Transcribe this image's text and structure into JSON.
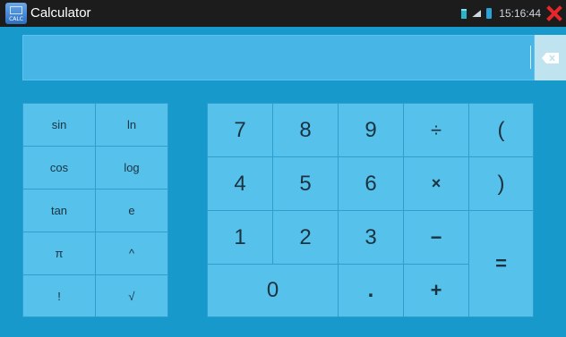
{
  "window": {
    "title": "Calculator",
    "app_icon_label": "CALC",
    "clock": "15:16:44"
  },
  "display": {
    "value": ""
  },
  "scientific": [
    {
      "label": "sin",
      "name": "sin-key"
    },
    {
      "label": "ln",
      "name": "ln-key"
    },
    {
      "label": "cos",
      "name": "cos-key"
    },
    {
      "label": "log",
      "name": "log-key"
    },
    {
      "label": "tan",
      "name": "tan-key"
    },
    {
      "label": "e",
      "name": "e-key"
    },
    {
      "label": "π",
      "name": "pi-key"
    },
    {
      "label": "^",
      "name": "power-key"
    },
    {
      "label": "!",
      "name": "factorial-key"
    },
    {
      "label": "√",
      "name": "sqrt-key"
    }
  ],
  "keypad": {
    "k7": "7",
    "k8": "8",
    "k9": "9",
    "div": "÷",
    "lparen": "(",
    "k4": "4",
    "k5": "5",
    "k6": "6",
    "mul": "×",
    "rparen": ")",
    "k1": "1",
    "k2": "2",
    "k3": "3",
    "sub": "−",
    "k0": "0",
    "dot": ".",
    "add": "+",
    "eq": "="
  },
  "colors": {
    "background": "#1799cc",
    "key": "#56c1ea",
    "display": "#47b6e6",
    "close": "#e8262a"
  }
}
